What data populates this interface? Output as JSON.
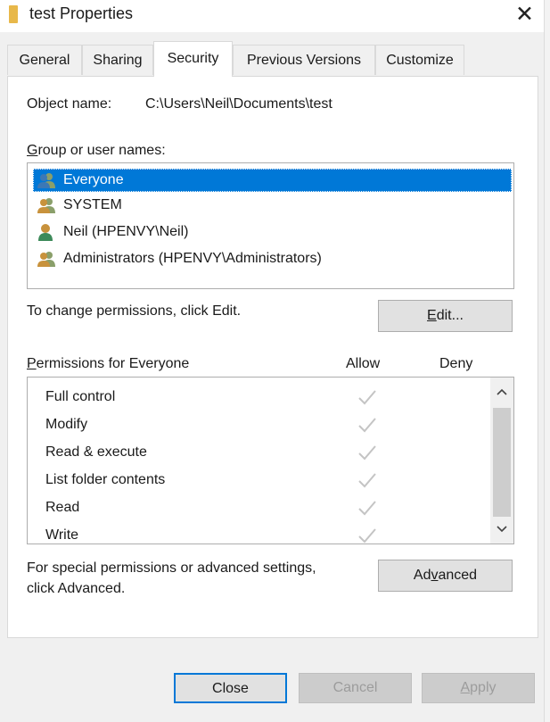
{
  "window": {
    "title": "test Properties",
    "close_glyph": "✕"
  },
  "tabs": [
    {
      "label": "General",
      "active": false
    },
    {
      "label": "Sharing",
      "active": false
    },
    {
      "label": "Security",
      "active": true
    },
    {
      "label": "Previous Versions",
      "active": false
    },
    {
      "label": "Customize",
      "active": false
    }
  ],
  "security": {
    "object_name_label": "Object name:",
    "object_name_value": "C:\\Users\\Neil\\Documents\\test",
    "group_label_first": "G",
    "group_label_rest": "roup or user names:",
    "users": [
      {
        "name": "Everyone",
        "icon": "users-group-icon",
        "selected": true
      },
      {
        "name": "SYSTEM",
        "icon": "users-group-icon",
        "selected": false
      },
      {
        "name": "Neil (HPENVY\\Neil)",
        "icon": "user-icon",
        "selected": false
      },
      {
        "name": "Administrators (HPENVY\\Administrators)",
        "icon": "users-group-icon",
        "selected": false
      }
    ],
    "change_hint": "To change permissions, click Edit.",
    "edit_button_first": "E",
    "edit_button_rest": "dit...",
    "perm_label_first": "P",
    "perm_label_rest": "ermissions for Everyone",
    "allow_header": "Allow",
    "deny_header": "Deny",
    "permissions": [
      {
        "name": "Full control",
        "allow": true,
        "deny": false
      },
      {
        "name": "Modify",
        "allow": true,
        "deny": false
      },
      {
        "name": "Read & execute",
        "allow": true,
        "deny": false
      },
      {
        "name": "List folder contents",
        "allow": true,
        "deny": false
      },
      {
        "name": "Read",
        "allow": true,
        "deny": false
      },
      {
        "name": "Write",
        "allow": true,
        "deny": false
      }
    ],
    "special_line1": "For special permissions or advanced settings,",
    "special_line2": "click Advanced.",
    "advanced_button_first": "Ad",
    "advanced_button_u": "v",
    "advanced_button_rest": "anced"
  },
  "footer": {
    "close": "Close",
    "cancel": "Cancel",
    "apply_first": "A",
    "apply_rest": "pply"
  },
  "colors": {
    "selection": "#0078d7",
    "check": "#c4c4c4",
    "dialog_bg": "#f0f0f0"
  }
}
